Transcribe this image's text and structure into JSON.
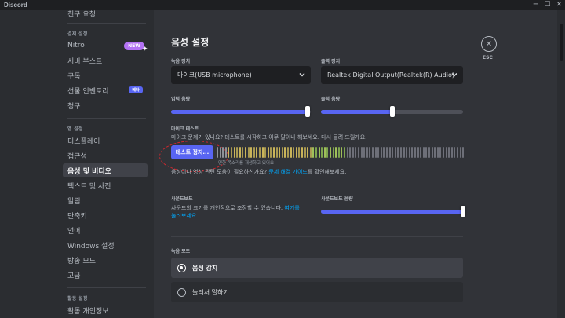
{
  "window": {
    "title": "Discord"
  },
  "sidebar": {
    "items": [
      {
        "label": "친구 요청"
      },
      {
        "label": "Nitro",
        "badge": "NEW"
      },
      {
        "label": "서버 부스트"
      },
      {
        "label": "구독"
      },
      {
        "label": "선물 인벤토리",
        "badge": "베타"
      },
      {
        "label": "청구"
      },
      {
        "label": "디스플레이"
      },
      {
        "label": "접근성"
      },
      {
        "label": "음성 및 비디오",
        "active": true
      },
      {
        "label": "텍스트 및 사진"
      },
      {
        "label": "알림"
      },
      {
        "label": "단축키"
      },
      {
        "label": "언어"
      },
      {
        "label": "Windows 설정"
      },
      {
        "label": "방송 모드"
      },
      {
        "label": "고급"
      },
      {
        "label": "활동 개인정보"
      }
    ],
    "headers": {
      "billing": "결제 설정",
      "app": "앱 설정",
      "activity": "활동 설정"
    }
  },
  "voice": {
    "heading": "음성 설정",
    "input_device_label": "녹음 장치",
    "input_device_value": "마이크(USB microphone)",
    "output_device_label": "출력 장치",
    "output_device_value": "Realtek Digital Output(Realtek(R) Audio)",
    "input_volume_label": "입력 음량",
    "input_volume_level": 0.98,
    "output_volume_label": "출력 음량",
    "output_volume_level": 0.5,
    "mic_test_label": "마이크 테스트",
    "mic_test_desc": "마이크 문제가 있나요? 테스트를 시작하고 아무 말이나 해보세요. 다시 들려 드릴게요.",
    "test_button": "테스트 정지...",
    "playback_note": "연한 목소리를 재생하고 있어요",
    "help_text": "음성이나 영상 관련 도움이 필요하신가요? ",
    "help_link": "문제 해결 가이드",
    "help_suffix": "를 확인해보세요.",
    "soundboard_label": "사운드보드",
    "soundboard_desc": "사운드의 크기를 개인적으로 조정할 수 있습니다. ",
    "soundboard_link": "여기를",
    "soundboard_link2": "눌러보세요.",
    "soundboard_volume_label": "사운드보드 음량",
    "soundboard_volume_level": 1.0,
    "input_mode_label": "녹음 모드",
    "input_mode_options": [
      {
        "label": "음성 감지",
        "selected": true
      },
      {
        "label": "눌러서 말하기",
        "selected": false
      }
    ]
  },
  "esc": {
    "label": "ESC"
  },
  "colors": {
    "accent": "#5865f2",
    "link": "#00a8fc",
    "nitro": "#b473f5",
    "annotation": "#d0282e"
  },
  "icons": [
    "chevron-down-icon",
    "close-icon",
    "sparkle-icon",
    "minimize-icon",
    "maximize-icon",
    "radio-icon"
  ]
}
